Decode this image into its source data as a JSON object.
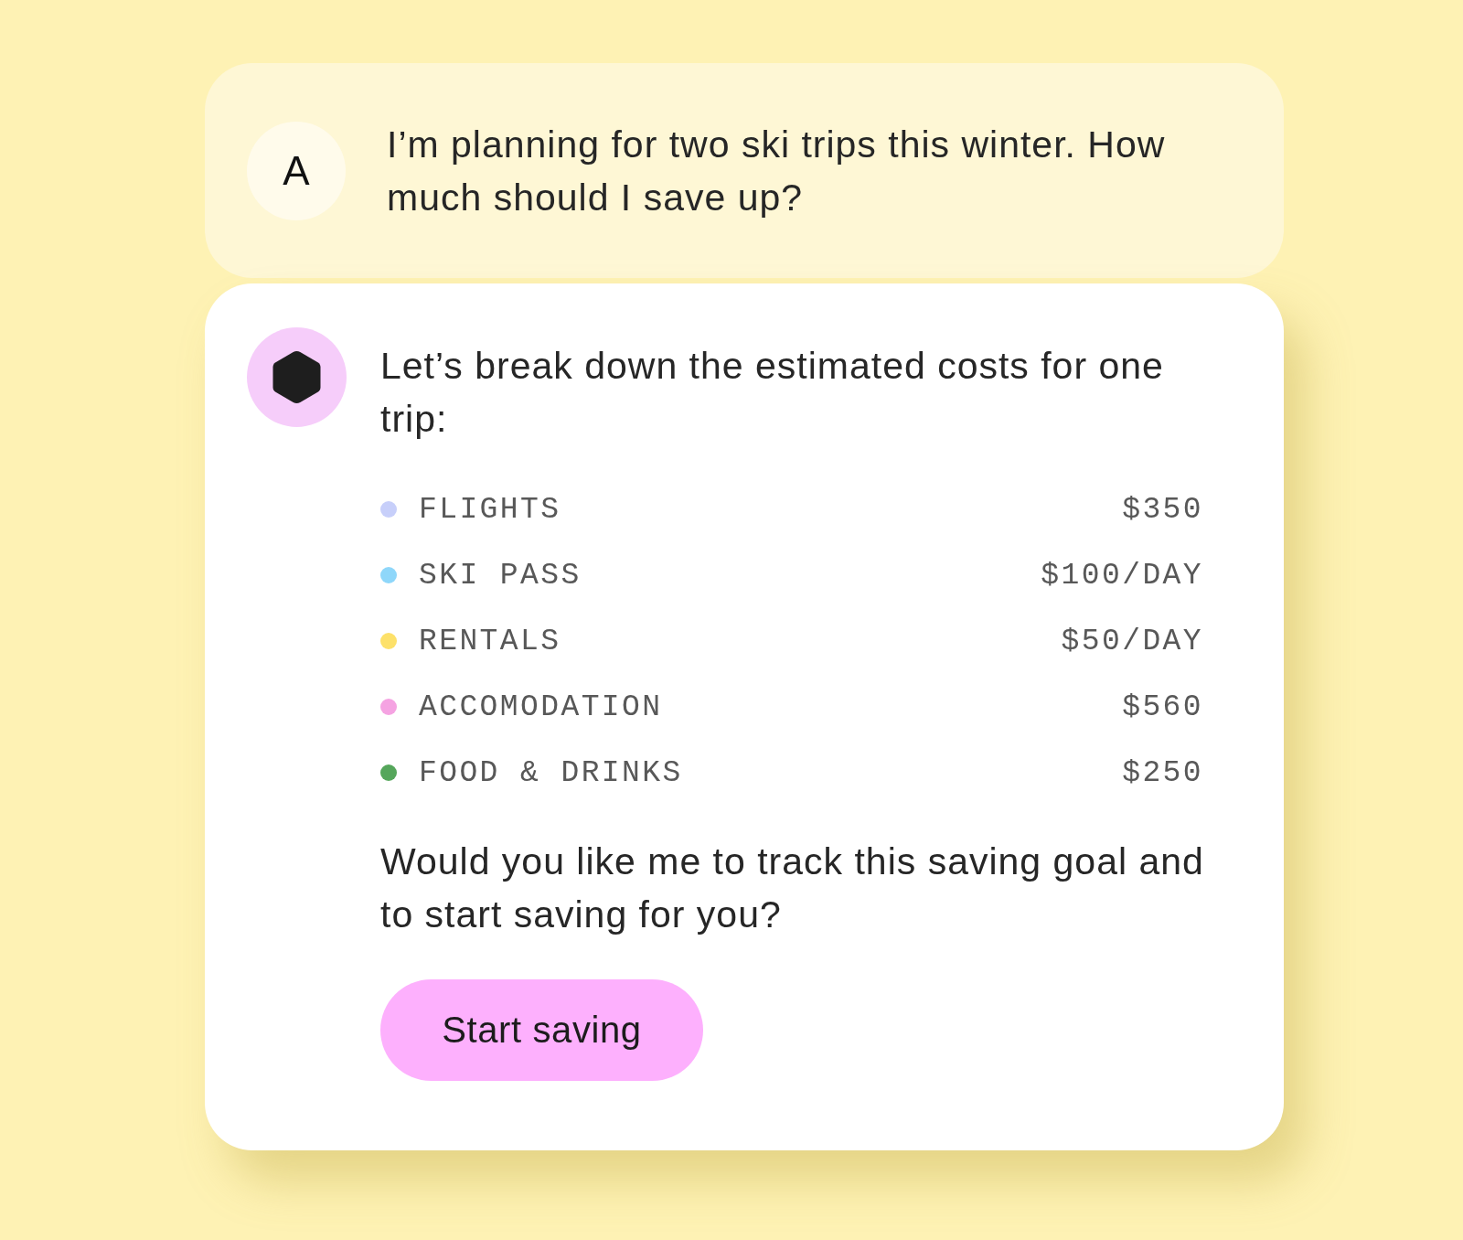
{
  "user_message": {
    "avatar": "A",
    "text": "I’m planning for two ski trips this winter. How much should I save up?"
  },
  "assistant_message": {
    "intro": "Let’s break down the estimated costs for one trip:",
    "costs": [
      {
        "label": "FLIGHTS",
        "amount": "$350",
        "color": "#c7cffa"
      },
      {
        "label": "SKI PASS",
        "amount": "$100/DAY",
        "color": "#8fd7fa"
      },
      {
        "label": "RENTALS",
        "amount": "$50/DAY",
        "color": "#fde16a"
      },
      {
        "label": "ACCOMODATION",
        "amount": "$560",
        "color": "#f5a3e2"
      },
      {
        "label": "FOOD & DRINKS",
        "amount": "$250",
        "color": "#55a65b"
      }
    ],
    "question": "Would you like me to track this saving goal and to start saving for you?",
    "button": "Start saving"
  }
}
